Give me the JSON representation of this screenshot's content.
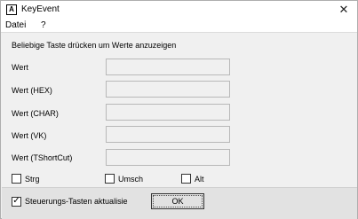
{
  "window": {
    "title": "KeyEvent",
    "app_icon_letter": "A",
    "close_glyph": "✕"
  },
  "menu": {
    "items": [
      {
        "label": "Datei"
      },
      {
        "label": "?"
      }
    ]
  },
  "main": {
    "header": "Beliebige Taste drücken um Werte anzuzeigen",
    "fields": [
      {
        "label": "Wert",
        "value": ""
      },
      {
        "label": "Wert (HEX)",
        "value": ""
      },
      {
        "label": "Wert (CHAR)",
        "value": ""
      },
      {
        "label": "Wert (VK)",
        "value": ""
      },
      {
        "label": "Wert (TShortCut)",
        "value": ""
      }
    ],
    "modifiers": [
      {
        "label": "Strg",
        "checked": false
      },
      {
        "label": "Umsch",
        "checked": false
      },
      {
        "label": "Alt",
        "checked": false
      }
    ]
  },
  "footer": {
    "toggle_label": "Steuerungs-Tasten aktualisie",
    "toggle_checked": true,
    "check_glyph": "✓",
    "ok_label": "OK"
  }
}
